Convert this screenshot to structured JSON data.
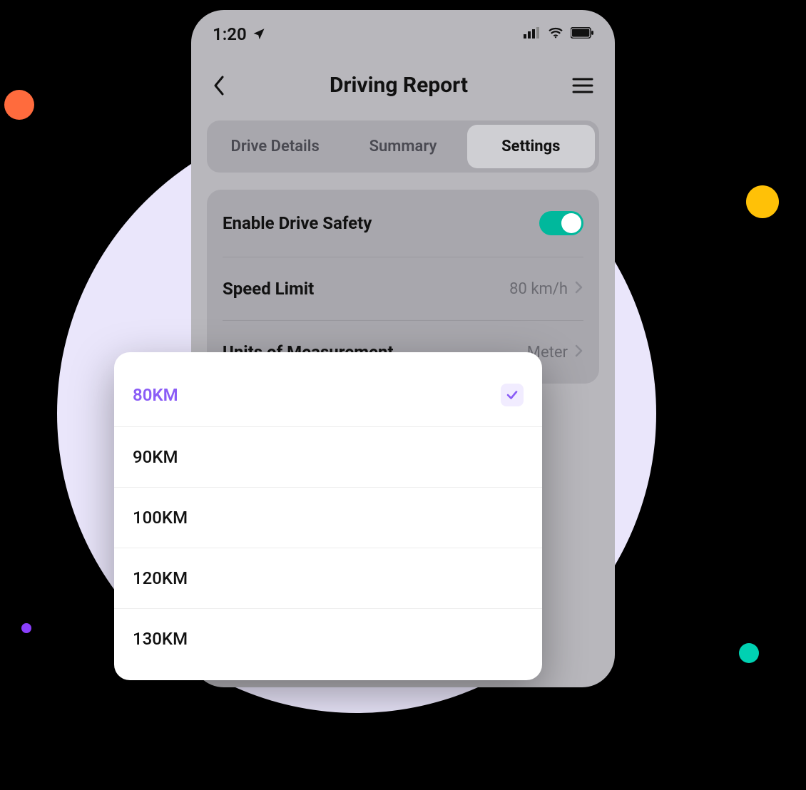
{
  "status": {
    "time": "1:20"
  },
  "header": {
    "title": "Driving Report"
  },
  "tabs": [
    {
      "label": "Drive Details",
      "active": false
    },
    {
      "label": "Summary",
      "active": false
    },
    {
      "label": "Settings",
      "active": true
    }
  ],
  "settings": {
    "enable_safety": {
      "label": "Enable Drive Safety",
      "on": true
    },
    "speed_limit": {
      "label": "Speed Limit",
      "value": "80 km/h"
    },
    "units": {
      "label": "Units of Measurement",
      "value": "Meter"
    }
  },
  "speed_options": [
    {
      "label": "80KM",
      "selected": true
    },
    {
      "label": "90KM",
      "selected": false
    },
    {
      "label": "100KM",
      "selected": false
    },
    {
      "label": "120KM",
      "selected": false
    },
    {
      "label": "130KM",
      "selected": false
    }
  ],
  "colors": {
    "accent_purple": "#8a5cf6",
    "toggle_on": "#00b89c"
  }
}
